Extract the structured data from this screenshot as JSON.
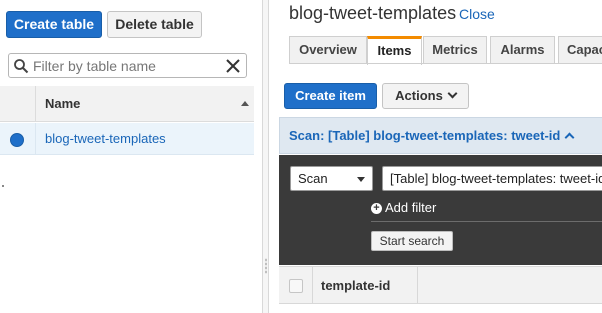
{
  "left_panel": {
    "create_table_label": "Create table",
    "delete_table_label": "Delete table",
    "filter_placeholder": "Filter by table name",
    "table": {
      "column_header": "Name",
      "rows": [
        {
          "name": "blog-tweet-templates",
          "selected": true
        }
      ]
    }
  },
  "right_panel": {
    "title": "blog-tweet-templates",
    "close_label": "Close",
    "tabs": [
      {
        "label": "Overview",
        "active": false
      },
      {
        "label": "Items",
        "active": true
      },
      {
        "label": "Metrics",
        "active": false
      },
      {
        "label": "Alarms",
        "active": false
      },
      {
        "label": "Capac",
        "active": false
      }
    ],
    "create_item_label": "Create item",
    "actions_label": "Actions",
    "scan_summary": "Scan: [Table] blog-tweet-templates: tweet-id",
    "scan_mode": "Scan",
    "scan_target": "[Table] blog-tweet-templates: tweet-id",
    "add_filter_label": "Add filter",
    "start_search_label": "Start search",
    "results_columns": [
      "template-id"
    ]
  },
  "colors": {
    "primary_button": "#1f6fc9",
    "link": "#1a66b8",
    "active_tab_accent": "#f38b00",
    "query_panel_bg": "#3a3a3a"
  },
  "icons": [
    "search-icon",
    "clear-icon",
    "sort-ascending-icon",
    "chevron-down-icon",
    "chevron-up-icon",
    "plus-circle-icon"
  ]
}
